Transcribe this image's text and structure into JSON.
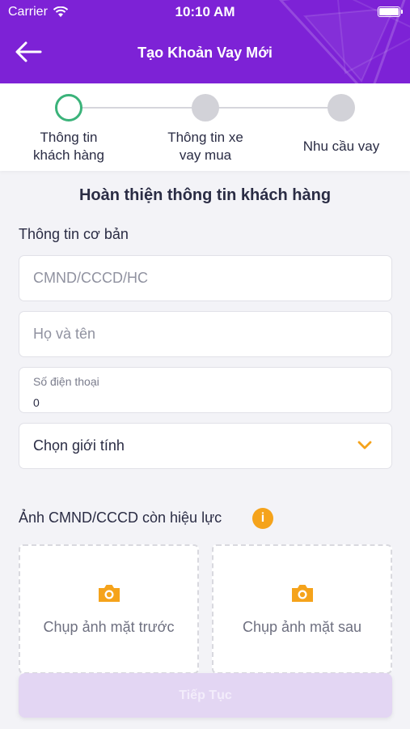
{
  "status_bar": {
    "carrier": "Carrier",
    "time": "10:10 AM"
  },
  "header": {
    "title": "Tạo Khoản Vay Mới",
    "back_icon": "arrow-left-icon"
  },
  "stepper": {
    "steps": [
      {
        "label_line1": "Thông tin",
        "label_line2": "khách hàng",
        "state": "active"
      },
      {
        "label_line1": "Thông tin xe",
        "label_line2": "vay mua",
        "state": "inactive"
      },
      {
        "label_line1": "Nhu cầu vay",
        "label_line2": "",
        "state": "inactive"
      }
    ]
  },
  "form": {
    "section_title": "Hoàn thiện thông tin khách hàng",
    "basic_info_label": "Thông tin cơ bản",
    "id_field": {
      "placeholder": "CMND/CCCD/HC",
      "value": ""
    },
    "name_field": {
      "placeholder": "Họ và tên",
      "value": ""
    },
    "phone_field": {
      "label": "Số điện thoại",
      "value": "0"
    },
    "gender_select": {
      "selected": "Chọn giới tính"
    },
    "id_photo_label": "Ảnh CMND/CCCD còn hiệu lực",
    "info_icon_text": "i",
    "front_photo_label": "Chụp ảnh mặt trước",
    "back_photo_label": "Chụp ảnh mặt sau",
    "next_button": "Tiếp Tục"
  },
  "colors": {
    "primary": "#7d22d6",
    "accent": "#f5a31b",
    "step_active": "#3bb37a"
  }
}
